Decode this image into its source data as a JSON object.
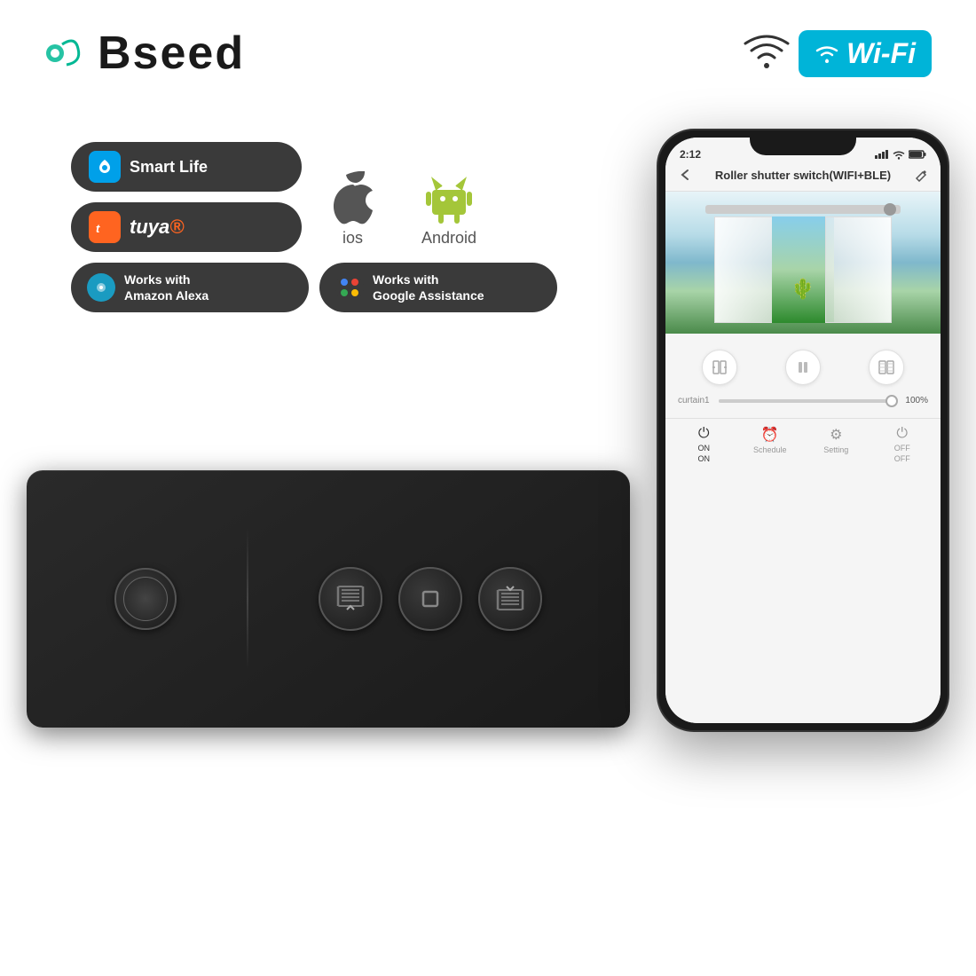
{
  "brand": {
    "name": "Bseed",
    "icon_alt": "bseed-logo"
  },
  "wifi_badge": {
    "text": "Wi-Fi",
    "color": "#00b4d8"
  },
  "badges": [
    {
      "id": "smart-life",
      "label": "Smart Life",
      "icon_color": "#00a0e9"
    },
    {
      "id": "tuya",
      "label": "tuya",
      "icon_color": "#ff6420"
    },
    {
      "id": "alexa",
      "line1": "Works with",
      "line2": "Amazon Alexa"
    },
    {
      "id": "google",
      "line1": "Works with",
      "line2": "Google Assistance"
    }
  ],
  "os_platforms": [
    {
      "name": "ios",
      "label": "ios"
    },
    {
      "name": "android",
      "label": "Android"
    }
  ],
  "phone": {
    "status_time": "2:12",
    "app_title": "Roller shutter switch(WIFI+BLE)",
    "curtain_label": "curtain1",
    "slider_value": "100%",
    "nav_items": [
      {
        "label": "ON",
        "sublabel": "ON"
      },
      {
        "label": "⏰",
        "sublabel": "Schedule"
      },
      {
        "label": "⚙",
        "sublabel": "Setting"
      },
      {
        "label": "OFF",
        "sublabel": "OFF"
      }
    ]
  }
}
